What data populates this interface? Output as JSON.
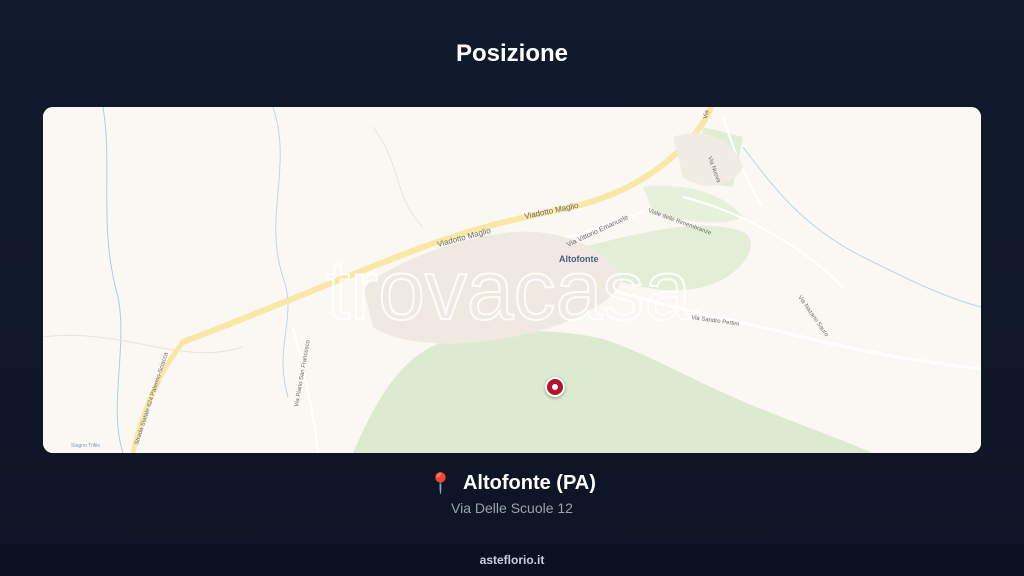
{
  "page": {
    "title": "Posizione"
  },
  "map": {
    "watermark": "trovacasa",
    "labels": {
      "town": "Altofonte",
      "viadotto_1": "Viadotto Maglio",
      "viadotto_2": "Viadotto Maglio",
      "via_vittorio": "Via Vittorio Emanuele",
      "via_rimembranze": "Viale delle Rimembranze",
      "via_sandro": "Via Sandro Pertini",
      "via_nazario": "Via Nazario Sauro",
      "strada_statale": "Strada Statale 624 Palermo-Sciacca",
      "via_nord": "Via Nuova",
      "via_san_francesco": "Via Piano San Francesco",
      "stagno": "Stagno Trifilo",
      "road_top": "Via"
    },
    "colors": {
      "background": "#fbf8f3",
      "green_area": "#d6e9c6",
      "road": "#fbeaa0",
      "pin": "#b3132c"
    }
  },
  "location": {
    "icon": "📍",
    "name": "Altofonte (PA)",
    "address": "Via Delle Scuole 12"
  },
  "footer": {
    "brand": "asteflorio.it"
  }
}
